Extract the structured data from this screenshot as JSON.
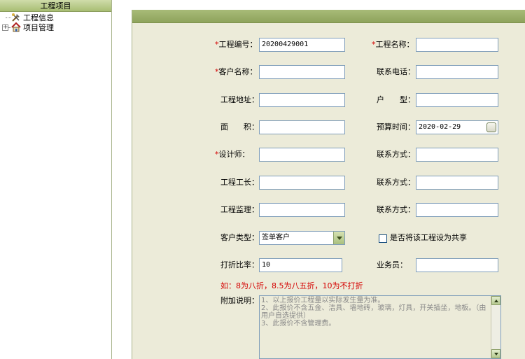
{
  "tree": {
    "header": "工程项目",
    "items": [
      {
        "label": "工程信息",
        "icon": "tools-icon"
      },
      {
        "label": "项目管理",
        "icon": "home-icon",
        "expander": "+"
      }
    ]
  },
  "form": {
    "project_no": {
      "label": "工程编号：",
      "value": "20200429001"
    },
    "project_name": {
      "label": "工程名称：",
      "value": ""
    },
    "client_name": {
      "label": "客户名称：",
      "value": ""
    },
    "contact_phone": {
      "label": "联系电话：",
      "value": ""
    },
    "address": {
      "label": "工程地址：",
      "value": ""
    },
    "house_type": {
      "label": "户　　型：",
      "value": ""
    },
    "area": {
      "label": "面　　积：",
      "value": ""
    },
    "budget_time": {
      "label": "预算时间：",
      "value": "2020-02-29"
    },
    "designer": {
      "label": "设计师：",
      "value": ""
    },
    "designer_contact": {
      "label": "联系方式：",
      "value": ""
    },
    "foreman": {
      "label": "工程工长：",
      "value": ""
    },
    "foreman_contact": {
      "label": "联系方式：",
      "value": ""
    },
    "supervisor": {
      "label": "工程监理：",
      "value": ""
    },
    "supervisor_contact": {
      "label": "联系方式：",
      "value": ""
    },
    "client_type": {
      "label": "客户类型：",
      "value": "签单客户"
    },
    "share_checkbox": {
      "label": "是否将该工程设为共享",
      "checked": false
    },
    "discount": {
      "label": "打折比率：",
      "value": "10"
    },
    "salesperson": {
      "label": "业务员：",
      "value": ""
    },
    "discount_hint": "如：8为八折，8.5为八五折，10为不打折",
    "notes": {
      "label": "附加说明：",
      "value": "1、以上报价工程量以实际发生量为准。\n2、此报价不含五金、洁具、墙地砖，玻璃，灯具，开关插坐，地板。（由用户自选提供）\n3、此报价不含管理费。"
    },
    "required_mark": "*"
  },
  "colors": {
    "panel_bg": "#ecebd9",
    "header_green": "#8ea35c",
    "required_red": "#d40000"
  }
}
